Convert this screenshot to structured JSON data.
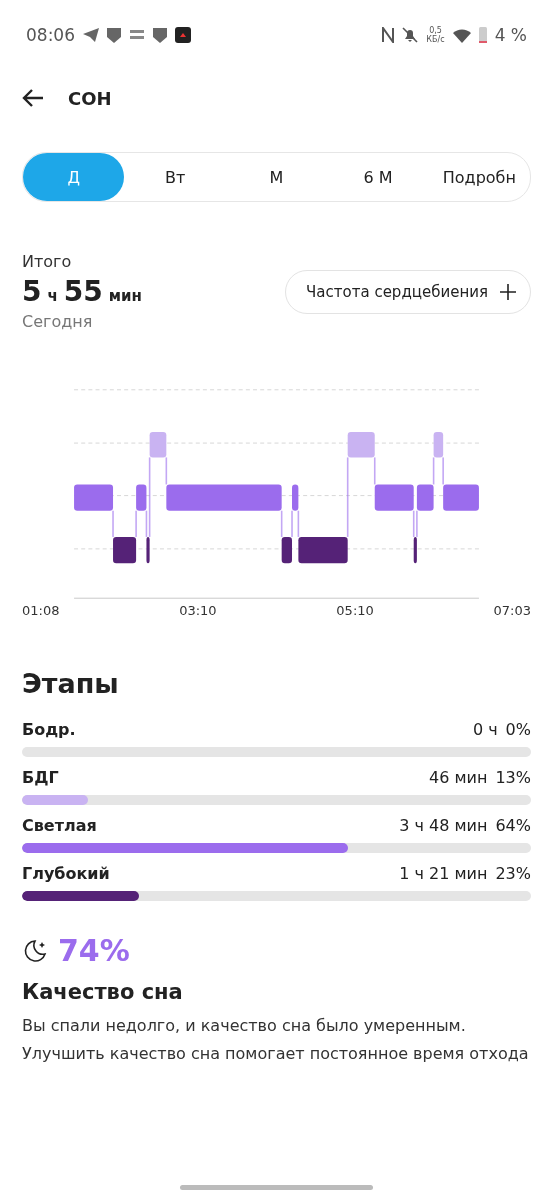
{
  "status_bar": {
    "time": "08:06",
    "speed_value": "0,5",
    "speed_unit": "КБ/с",
    "battery": "4 %"
  },
  "header": {
    "title": "СОН"
  },
  "tabs": [
    {
      "label": "Д",
      "selected": true
    },
    {
      "label": "Вт",
      "selected": false
    },
    {
      "label": "М",
      "selected": false
    },
    {
      "label": "6 М",
      "selected": false
    },
    {
      "label": "Подробн",
      "selected": false
    }
  ],
  "summary": {
    "label": "Итого",
    "hours": "5",
    "hours_unit": "ч",
    "minutes": "55",
    "minutes_unit": "мин",
    "date": "Сегодня"
  },
  "heart_rate_button": {
    "label": "Частота сердцебиения"
  },
  "chart": {
    "x_labels": [
      "01:08",
      "03:10",
      "05:10",
      "07:03"
    ]
  },
  "stages": {
    "title": "Этапы",
    "items": [
      {
        "name": "Бодр.",
        "duration": "0 ч",
        "percent": "0%"
      },
      {
        "name": "БДГ",
        "duration": "46 мин",
        "percent": "13%",
        "level": 0.13,
        "color": "#c9b3f2"
      },
      {
        "name": "Светлая",
        "duration": "3 ч 48 мин",
        "percent": "64%",
        "level": 0.64,
        "color": "#9b6ced"
      },
      {
        "name": "Глубокий",
        "duration": "1 ч 21 мин",
        "percent": "23%",
        "level": 0.23,
        "color": "#552277"
      }
    ]
  },
  "quality": {
    "score": "74%",
    "title": "Качество сна",
    "text": "Вы спали недолго, и качество сна было умеренным. Улучшить качество сна помогает постоянное время отхода"
  }
}
